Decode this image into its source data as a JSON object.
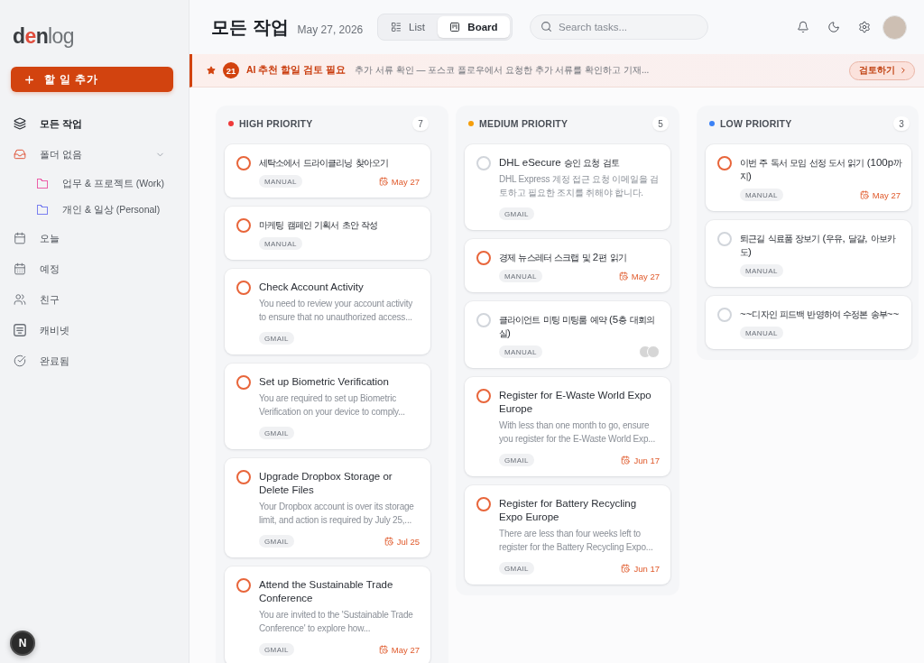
{
  "sidebar": {
    "logo": "denlog",
    "add_button": "할 일 추가",
    "nav": [
      {
        "label": "모든 작업",
        "selected": true
      },
      {
        "label": "폴더 없음",
        "selected": false,
        "expanded": true,
        "children": [
          {
            "label": "업무 & 프로젝트 (Work)",
            "selected": false,
            "color": "#ec5fa8"
          },
          {
            "label": "개인 & 일상 (Personal)",
            "selected": false,
            "color": "#7a7ff0"
          }
        ]
      },
      {
        "label": "오늘",
        "selected": false
      },
      {
        "label": "예정",
        "selected": false
      },
      {
        "label": "친구",
        "selected": false
      },
      {
        "label": "캐비넷",
        "selected": false
      },
      {
        "label": "완료됨",
        "selected": false
      }
    ],
    "dev_badge": "N"
  },
  "header": {
    "title": "모든 작업",
    "date": "May 27, 2026",
    "views": [
      {
        "label": "List",
        "selected": false
      },
      {
        "label": "Board",
        "selected": true
      }
    ],
    "search": {
      "placeholder": "Search tasks..."
    }
  },
  "banner": {
    "count": "21",
    "title": "AI 추천 할일 검토 필요",
    "message": "추가 서류 확인 — 포스코 플로우에서 요청한 추가 서류를 확인하고 기재...",
    "action": "검토하기"
  },
  "columns": [
    {
      "title": "HIGH PRIORITY",
      "color": "#ef3a3a",
      "count": "7",
      "cards": [
        {
          "title": "세탁소에서 드라이클리닝 찾아오기",
          "source": "MANUAL",
          "due": "May 27",
          "checked": false,
          "color": "#e8653a",
          "shared": false
        },
        {
          "title": "마케팅 캠페인 기획서 초안 작성",
          "source": "MANUAL",
          "checked": false,
          "color": "#e8653a",
          "shared": false
        },
        {
          "title": "Check Account Activity",
          "description": "You need to review your account activity to ensure that no unauthorized access...",
          "source": "GMAIL",
          "checked": false,
          "color": "#e8653a",
          "shared": false
        },
        {
          "title": "Set up Biometric Verification",
          "description": "You are required to set up Biometric Verification on your device to comply...",
          "source": "GMAIL",
          "checked": false,
          "color": "#e8653a",
          "shared": false
        },
        {
          "title": "Upgrade Dropbox Storage or Delete Files",
          "description": "Your Dropbox account is over its storage limit, and action is required by July 25,...",
          "source": "GMAIL",
          "due": "Jul 25",
          "checked": false,
          "color": "#e8653a",
          "shared": false
        },
        {
          "title": "Attend the Sustainable Trade Conference",
          "description": "You are invited to the 'Sustainable Trade Conference' to explore how...",
          "source": "GMAIL",
          "due": "May 27",
          "checked": false,
          "color": "#e8653a",
          "shared": false
        }
      ]
    },
    {
      "title": "MEDIUM PRIORITY",
      "color": "#f59e0b",
      "count": "5",
      "cards": [
        {
          "title": "DHL eSecure 승인 요청 검토",
          "description": "DHL Express 계정 접근 요청 이메일을 검토하고 필요한 조치를 취해야 합니다.",
          "source": "GMAIL",
          "checked": false,
          "color": "#d1d5db",
          "shared": false
        },
        {
          "title": "경제 뉴스레터 스크랩 및 2편 읽기",
          "source": "MANUAL",
          "due": "May 27",
          "checked": false,
          "color": "#e8653a",
          "shared": false
        },
        {
          "title": "클라이언트 미팅 미팅룸 예약 (5층 대회의실)",
          "source": "MANUAL",
          "checked": false,
          "color": "#d1d5db",
          "shared": true
        },
        {
          "title": "Register for E-Waste World Expo Europe",
          "description": "With less than one month to go, ensure you register for the E-Waste World Exp...",
          "source": "GMAIL",
          "due": "Jun 17",
          "checked": false,
          "color": "#e8653a",
          "shared": false
        },
        {
          "title": "Register for Battery Recycling Expo Europe",
          "description": "There are less than four weeks left to register for the Battery Recycling Expo...",
          "source": "GMAIL",
          "due": "Jun 17",
          "checked": false,
          "color": "#e8653a",
          "shared": false
        }
      ]
    },
    {
      "title": "LOW PRIORITY",
      "color": "#3b82f6",
      "count": "3",
      "cards": [
        {
          "title": "이번 주 독서 모임 선정 도서 읽기 (100p까지)",
          "source": "MANUAL",
          "due": "May 27",
          "checked": false,
          "color": "#e8653a",
          "shared": false
        },
        {
          "title": "퇴근길 식료품 장보기 (우유, 달걀, 아보카도)",
          "source": "MANUAL",
          "checked": false,
          "color": "#d1d5db",
          "shared": false
        },
        {
          "title": "~~디자인 피드백 반영하여 수정본 송부~~",
          "source": "MANUAL",
          "checked": false,
          "color": "#d1d5db",
          "shared": false
        }
      ]
    }
  ]
}
